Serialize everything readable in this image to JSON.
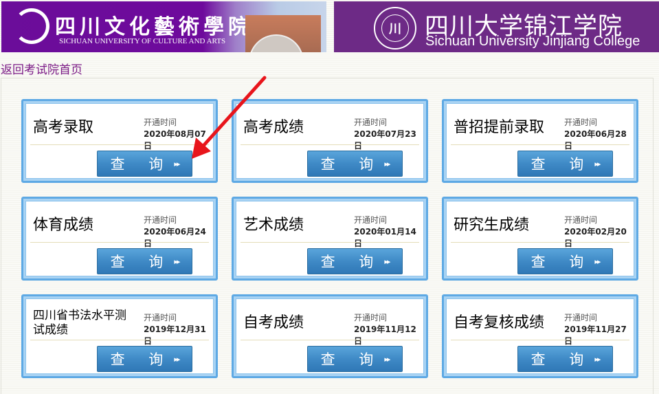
{
  "header": {
    "left_banner": {
      "name_cn": "四川文化藝術學院",
      "name_en": "SICHUAN UNIVERSITY OF CULTURE AND ARTS"
    },
    "right_banner": {
      "name_cn": "四川大学锦江学院",
      "name_en": "Sichuan University Jinjiang College",
      "seal_text": "川"
    }
  },
  "back_link": "返回考试院首页",
  "open_label": "开通时间",
  "button_label": "查 询",
  "button_arrow": "▸▸",
  "cards": [
    {
      "title": "高考录取",
      "date": "2020年08月07日"
    },
    {
      "title": "高考成绩",
      "date": "2020年07月23日"
    },
    {
      "title": "普招提前录取",
      "date": "2020年06月28日"
    },
    {
      "title": "体育成绩",
      "date": "2020年06月24日"
    },
    {
      "title": "艺术成绩",
      "date": "2020年01月14日"
    },
    {
      "title": "研究生成绩",
      "date": "2020年02月20日"
    },
    {
      "title": "四川省书法水平测试成绩",
      "date": "2019年12月31日"
    },
    {
      "title": "自考成绩",
      "date": "2019年11月12日"
    },
    {
      "title": "自考复核成绩",
      "date": "2019年11月27日"
    }
  ],
  "colors": {
    "accent": "#3f8ac6",
    "link": "#7b1a86",
    "annotation_arrow": "#e8151b"
  }
}
